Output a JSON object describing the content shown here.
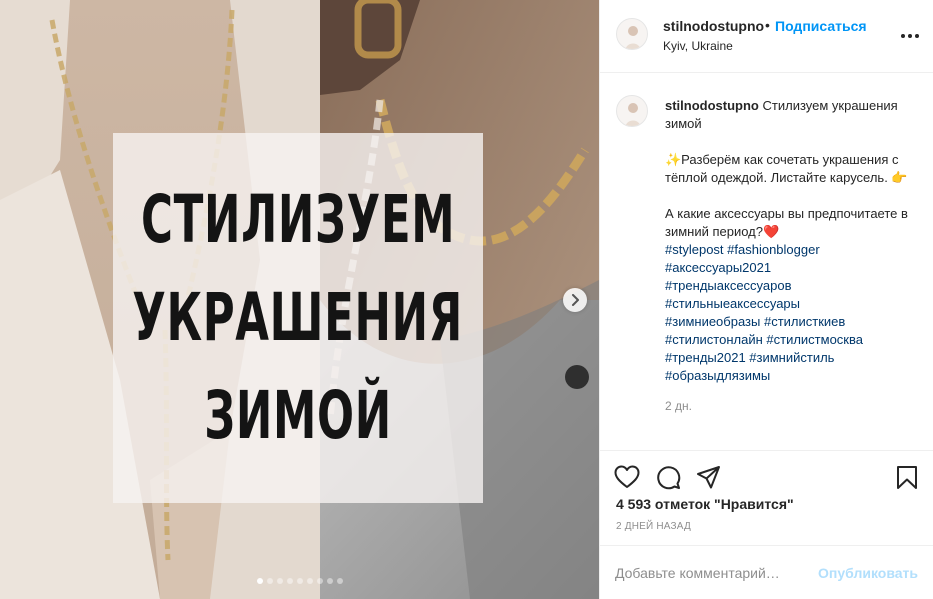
{
  "post": {
    "image": {
      "overlay_lines": [
        "СТИЛИЗУЕМ",
        "УКРАШЕНИЯ",
        "ЗИМОЙ"
      ],
      "carousel_count": 9,
      "carousel_active": 0
    },
    "header": {
      "username": "stilnodostupno",
      "separator": "•",
      "follow_label": "Подписаться",
      "location": "Kyiv, Ukraine"
    },
    "caption": {
      "username": "stilnodostupno",
      "title": "Стилизуем украшения зимой",
      "line1": "✨Разберём как сочетать украшения с тёплой одеждой. Листайте карусель. 👉",
      "line2": "А какие аксессуары вы предпочитаете в зимний период?❤️",
      "hashtag_lines": [
        "#stylepost #fashionblogger",
        "#аксессуары2021",
        "#трендыаксессуаров",
        "#стильныеаксессуары",
        "#зимниеобразы #стилисткиев",
        "#стилистонлайн #стилистмосква",
        "#тренды2021 #зимнийстиль",
        "#образыдлязимы"
      ],
      "time": "2 дн."
    },
    "likes_text": "4 593 отметок \"Нравится\"",
    "date_text": "2 ДНЕЙ НАЗАД",
    "comment_placeholder": "Добавьте комментарий…",
    "publish_label": "Опубликовать"
  },
  "colors": {
    "accent": "#0095f6",
    "publish_disabled": "#b2dffc",
    "hashtag": "#00376b",
    "muted": "#8e8e8e",
    "text": "#262626"
  },
  "icons": [
    "chevron-right-icon",
    "more-icon",
    "heart-icon",
    "comment-icon",
    "share-icon",
    "bookmark-icon"
  ]
}
